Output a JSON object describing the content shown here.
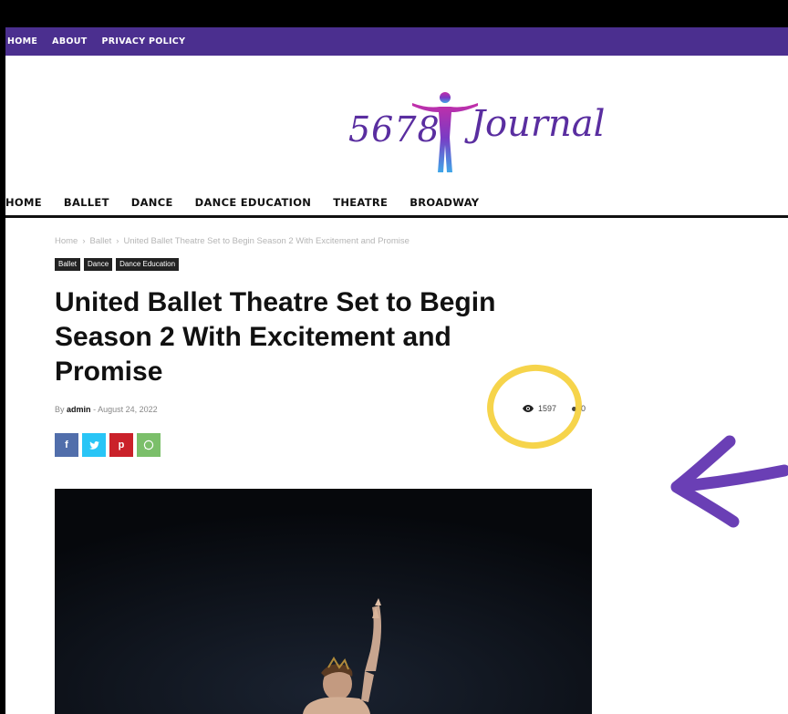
{
  "topbar": {
    "links": [
      "HOME",
      "ABOUT",
      "PRIVACY POLICY"
    ]
  },
  "logo": {
    "digits": "5678",
    "script": "Journal"
  },
  "mainnav": {
    "links": [
      "HOME",
      "BALLET",
      "DANCE",
      "DANCE EDUCATION",
      "THEATRE",
      "BROADWAY"
    ]
  },
  "breadcrumb": {
    "items": [
      "Home",
      "›",
      "Ballet",
      "›",
      "United Ballet Theatre Set to Begin Season 2 With Excitement and Promise"
    ]
  },
  "tags": [
    "Ballet",
    "Dance",
    "Dance Education"
  ],
  "article": {
    "title": "United Ballet Theatre Set to Begin Season 2 With Excitement and Promise",
    "by": "By",
    "author": "admin",
    "separator": "-",
    "date": "August 24, 2022",
    "views": "1597",
    "comments": "0"
  },
  "share": {
    "facebook": "f",
    "twitter": "t",
    "pinterest": "p",
    "whatsapp": "w"
  },
  "colors": {
    "topbar": "#4b2f8f",
    "logo": "#5a2ea0",
    "highlight": "#f5cc2c",
    "arrow": "#6a3fb5"
  }
}
